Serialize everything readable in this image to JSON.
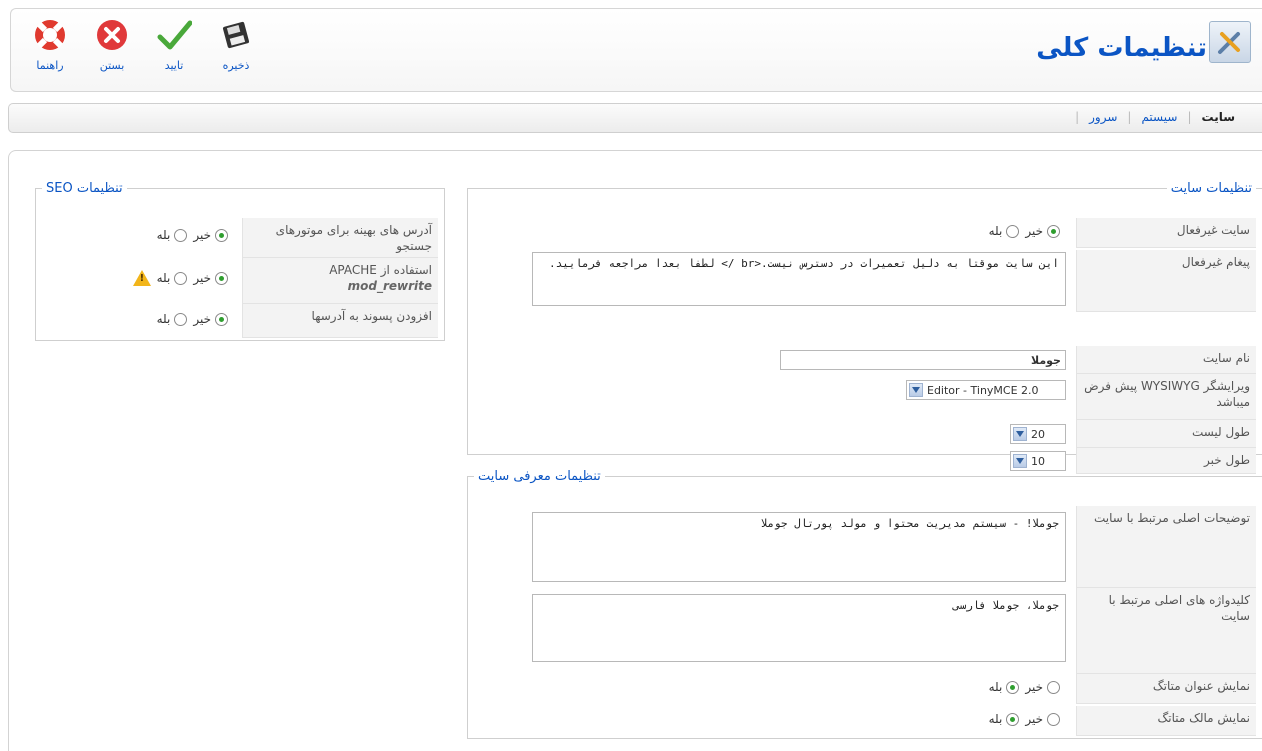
{
  "header": {
    "title": "تنظیمات کلی",
    "toolbar": [
      {
        "id": "help",
        "label": "راهنما",
        "icon": "lifebuoy-icon"
      },
      {
        "id": "close",
        "label": "بستن",
        "icon": "close-circle-icon"
      },
      {
        "id": "apply",
        "label": "تایید",
        "icon": "checkmark-icon"
      },
      {
        "id": "save",
        "label": "ذخیره",
        "icon": "floppy-disk-icon"
      }
    ]
  },
  "submenu": {
    "items": [
      "سایت",
      "سیستم",
      "سرور"
    ],
    "active": "سایت"
  },
  "site_settings": {
    "legend": "تنظیمات سایت",
    "offline_label": "سایت غیرفعال",
    "offline_no": "خیر",
    "offline_yes": "بله",
    "offline_message_label": "پیغام غیرفعال",
    "offline_message": "این سایت موقتا به دلیل تعمیرات در دسترس نیست.<br /> لطفا بعدا مراجعه فرمایید.",
    "site_name_label": "نام سایت",
    "site_name": "جوملا",
    "editor_label": "ویرایشگر WYSIWYG پیش فرض میباشد",
    "editor_value": "Editor - TinyMCE 2.0",
    "list_length_label": "طول لیست",
    "list_length_value": "20",
    "news_length_label": "طول خبر",
    "news_length_value": "10"
  },
  "meta_settings": {
    "legend": "تنظیمات معرفی سایت",
    "description_label": "توضیحات اصلی مرتبط با سایت",
    "description": "جوملا! - سیستم مدیریت محتوا و مولد پورتال جوملا",
    "keywords_label": "کلیدواژه های اصلی مرتبط با سایت",
    "keywords": "جوملا، جوملا فارسی",
    "show_title_label": "نمایش عنوان متاتگ",
    "show_author_label": "نمایش مالک متاتگ",
    "no": "خیر",
    "yes": "بله"
  },
  "seo_settings": {
    "legend": "تنظیمات SEO",
    "sef_label": "آدرس های بهینه برای موتورهای جستجو",
    "rewrite_label": "استفاده از APACHE",
    "rewrite_label2": "mod_rewrite",
    "suffix_label": "افزودن پسوند به آدرسها",
    "no": "خیر",
    "yes": "بله"
  },
  "colors": {
    "link": "#0B55C4",
    "radio_on": "#2f9e2f",
    "warning": "#f2b51a"
  }
}
